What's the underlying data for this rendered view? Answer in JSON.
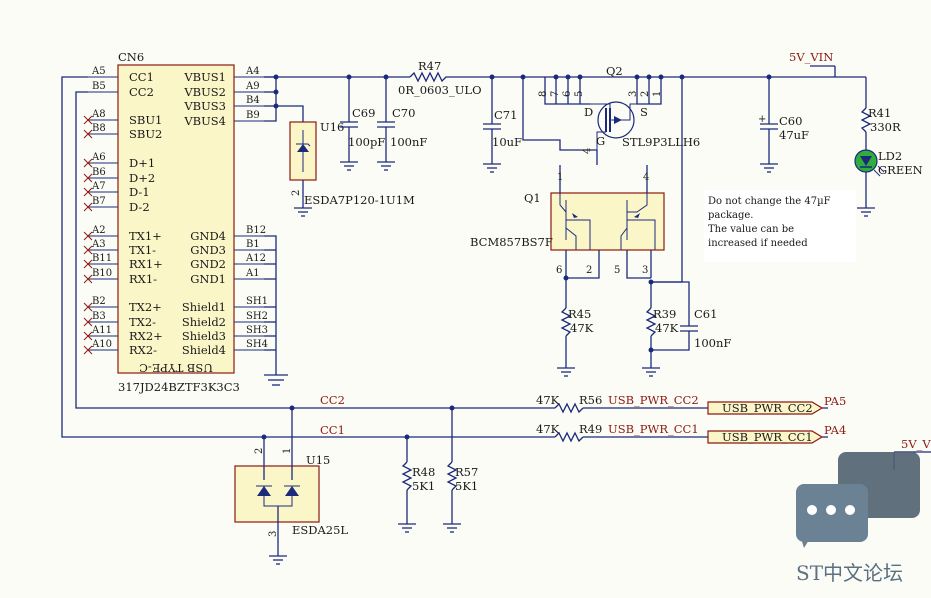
{
  "connector": {
    "ref": "CN6",
    "part": "317JD24BZTF3K3C3",
    "body_label": "USB TYPE-C",
    "left_pins": [
      {
        "num": "A5",
        "name": "CC1"
      },
      {
        "num": "B5",
        "name": "CC2"
      },
      {
        "num": "A8",
        "name": "SBU1"
      },
      {
        "num": "B8",
        "name": "SBU2"
      },
      {
        "num": "A6",
        "name": "D+1"
      },
      {
        "num": "B6",
        "name": "D+2"
      },
      {
        "num": "A7",
        "name": "D-1"
      },
      {
        "num": "B7",
        "name": "D-2"
      },
      {
        "num": "A2",
        "name": "TX1+"
      },
      {
        "num": "A3",
        "name": "TX1-"
      },
      {
        "num": "B11",
        "name": "RX1+"
      },
      {
        "num": "B10",
        "name": "RX1-"
      },
      {
        "num": "B2",
        "name": "TX2+"
      },
      {
        "num": "B3",
        "name": "TX2-"
      },
      {
        "num": "A11",
        "name": "RX2+"
      },
      {
        "num": "A10",
        "name": "RX2-"
      }
    ],
    "right_pins": [
      {
        "num": "A4",
        "name": "VBUS1"
      },
      {
        "num": "A9",
        "name": "VBUS2"
      },
      {
        "num": "B4",
        "name": "VBUS3"
      },
      {
        "num": "B9",
        "name": "VBUS4"
      },
      {
        "num": "B12",
        "name": "GND4"
      },
      {
        "num": "B1",
        "name": "GND3"
      },
      {
        "num": "A12",
        "name": "GND2"
      },
      {
        "num": "A1",
        "name": "GND1"
      },
      {
        "num": "SH1",
        "name": "Shield1"
      },
      {
        "num": "SH2",
        "name": "Shield2"
      },
      {
        "num": "SH3",
        "name": "Shield3"
      },
      {
        "num": "SH4",
        "name": "Shield4"
      }
    ]
  },
  "u16": {
    "ref": "U16",
    "part": "ESDA7P120-1U1M",
    "pin2": "2"
  },
  "c69": {
    "ref": "C69",
    "value": "100pF"
  },
  "c70": {
    "ref": "C70",
    "value": "100nF"
  },
  "r47": {
    "ref": "R47",
    "value": "0R_0603_ULO"
  },
  "c71": {
    "ref": "C71",
    "value": "10uF"
  },
  "q2": {
    "ref": "Q2",
    "part": "STL9P3LLH6",
    "pins": [
      "8",
      "7",
      "6",
      "5",
      "4",
      "3",
      "2",
      "1"
    ],
    "d": "D",
    "g": "G",
    "s": "S"
  },
  "q1": {
    "ref": "Q1",
    "part": "BCM857BS7F",
    "pins": [
      "1",
      "4",
      "6",
      "2",
      "5",
      "3"
    ]
  },
  "c60": {
    "ref": "C60",
    "value": "47uF",
    "plus": "+"
  },
  "vin": {
    "label": "5V_VIN"
  },
  "vin2": {
    "label": "5V_V"
  },
  "r41": {
    "ref": "R41",
    "value": "330R"
  },
  "ld2": {
    "ref": "LD2",
    "value": "GREEN"
  },
  "note": {
    "line1": "Do not change the 47µF",
    "line2": "package.",
    "line3": "The value can be",
    "line4": "increased if needed"
  },
  "r45": {
    "ref": "R45",
    "value": "47K"
  },
  "r39": {
    "ref": "R39",
    "value": "47K"
  },
  "c61": {
    "ref": "C61",
    "value": "100nF"
  },
  "cc2": {
    "net": "CC2",
    "rref": "R56",
    "rval": "47K",
    "port": "USB_PWR_CC2",
    "pin": "PA5"
  },
  "cc1": {
    "net": "CC1",
    "rref": "R49",
    "rval": "47K",
    "port": "USB_PWR_CC1",
    "pin": "PA4"
  },
  "r48": {
    "ref": "R48",
    "value": "5K1"
  },
  "r57": {
    "ref": "R57",
    "value": "5K1"
  },
  "u15": {
    "ref": "U15",
    "part": "ESDA25L",
    "pins": [
      "2",
      "1",
      "3"
    ]
  },
  "watermark": {
    "text": "ST中文论坛"
  }
}
